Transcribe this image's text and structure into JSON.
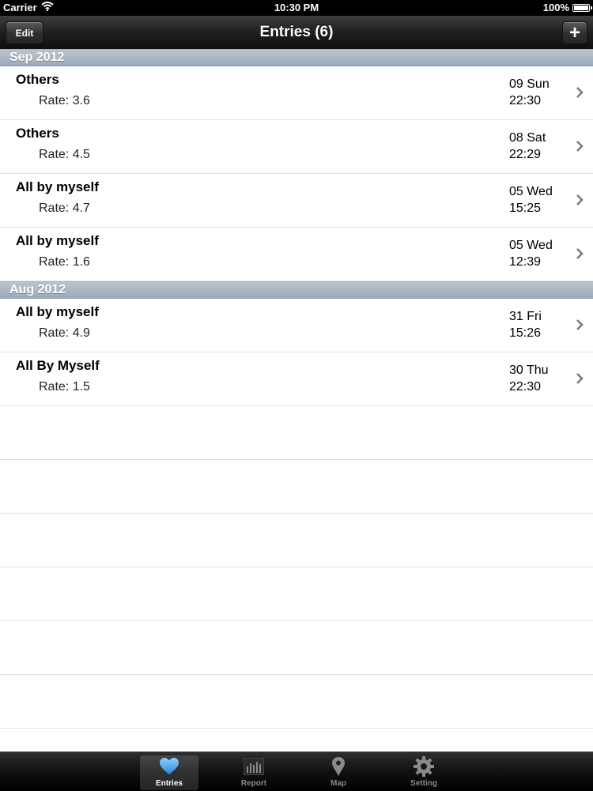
{
  "status_bar": {
    "carrier": "Carrier",
    "time": "10:30 PM",
    "battery": "100%"
  },
  "nav_bar": {
    "title": "Entries (6)",
    "edit_label": "Edit",
    "add_label": "+"
  },
  "sections": [
    {
      "header": "Sep 2012",
      "entries": [
        {
          "title": "Others",
          "rate": "Rate: 3.6",
          "date": "09 Sun",
          "time": "22:30"
        },
        {
          "title": "Others",
          "rate": "Rate: 4.5",
          "date": "08 Sat",
          "time": "22:29"
        },
        {
          "title": "All by myself",
          "rate": "Rate: 4.7",
          "date": "05 Wed",
          "time": "15:25"
        },
        {
          "title": "All by myself",
          "rate": "Rate: 1.6",
          "date": "05 Wed",
          "time": "12:39"
        }
      ]
    },
    {
      "header": "Aug 2012",
      "entries": [
        {
          "title": "All by myself",
          "rate": "Rate: 4.9",
          "date": "31 Fri",
          "time": "15:26"
        },
        {
          "title": "All By Myself",
          "rate": "Rate: 1.5",
          "date": "30 Thu",
          "time": "22:30"
        }
      ]
    }
  ],
  "tab_bar": {
    "tabs": [
      {
        "label": "Entries",
        "icon": "heart-icon",
        "active": true
      },
      {
        "label": "Report",
        "icon": "bar-chart-icon",
        "active": false
      },
      {
        "label": "Map",
        "icon": "map-pin-icon",
        "active": false
      },
      {
        "label": "Setting",
        "icon": "gear-icon",
        "active": false
      }
    ]
  },
  "colors": {
    "accent_blue": "#4aa3e6",
    "section_header": "#a9b6c2",
    "nav_bar": "#1f1f1f"
  }
}
